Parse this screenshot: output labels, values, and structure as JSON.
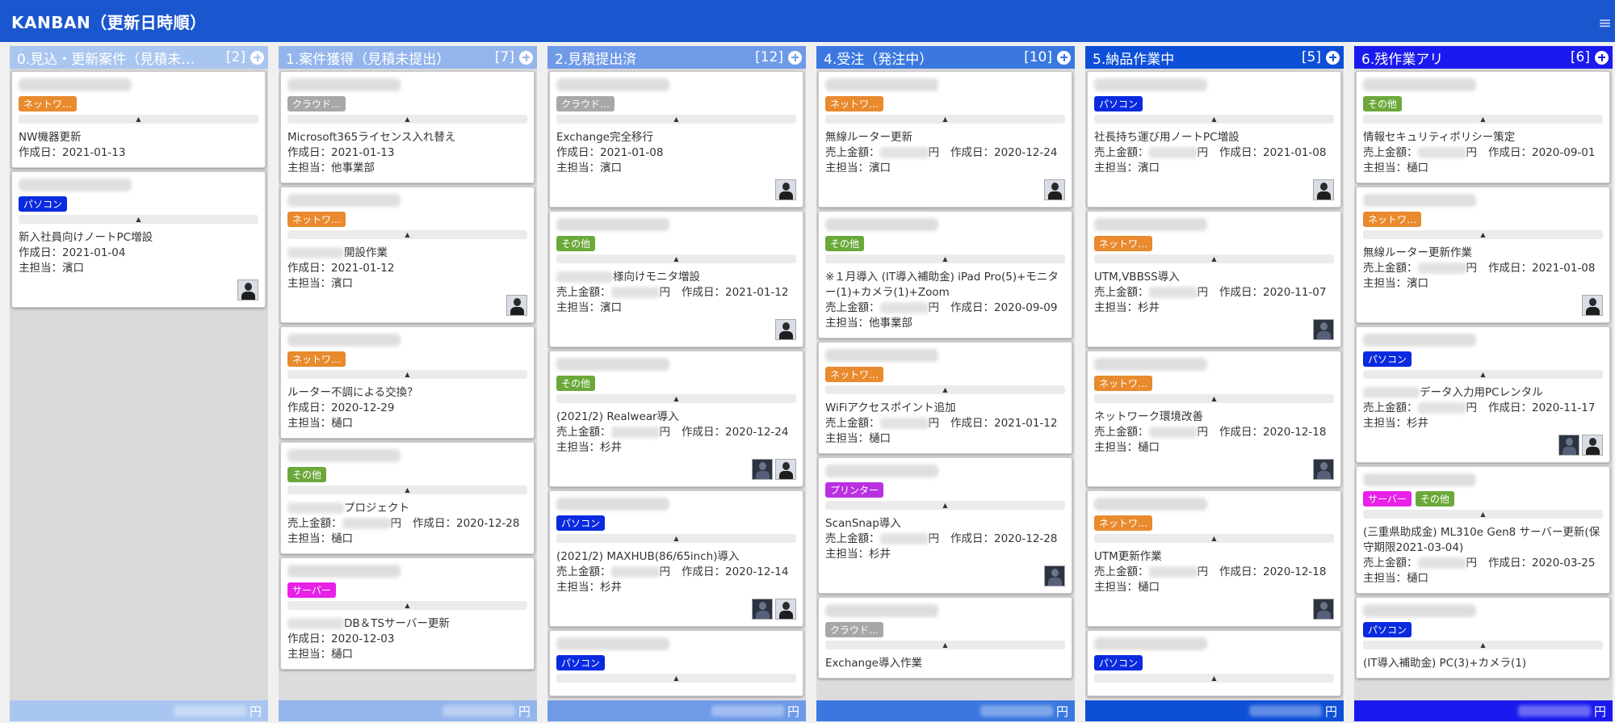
{
  "header": {
    "title": "KANBAN（更新日時順）",
    "menu_icon": "≡"
  },
  "colors": {
    "network": "#e88a2d",
    "cloud": "#a7a7a7",
    "pc": "#0a2ae0",
    "other": "#6ba83a",
    "server": "#e820e8",
    "printer": "#b830e0"
  },
  "columns": [
    {
      "title": "0.見込・更新案件（見積未…",
      "count": "[2]",
      "header_color": "#a9c6f0",
      "footer_color": "#a9c6f0",
      "footer_text": "円",
      "cards": [
        {
          "tags": [
            {
              "label": "ネットワ…",
              "type": "network"
            }
          ],
          "title": "NW機器更新",
          "lines": [
            "作成日：2021-01-13"
          ],
          "avatars": []
        },
        {
          "tags": [
            {
              "label": "パソコン",
              "type": "pc"
            }
          ],
          "title": "新入社員向けノートPC増設",
          "lines": [
            "作成日：2021-01-04",
            "主担当：濱口"
          ],
          "avatars": [
            "light"
          ]
        }
      ]
    },
    {
      "title": "1.案件獲得（見積未提出）",
      "count": "[7]",
      "header_color": "#93b5ec",
      "footer_color": "#93b5ec",
      "footer_text": "円",
      "cards": [
        {
          "tags": [
            {
              "label": "クラウド…",
              "type": "cloud"
            }
          ],
          "title": "Microsoft365ライセンス入れ替え",
          "lines": [
            "作成日：2021-01-13",
            "主担当：他事業部"
          ],
          "avatars": []
        },
        {
          "tags": [
            {
              "label": "ネットワ…",
              "type": "network"
            }
          ],
          "title": "開設作業",
          "blur_prefix": true,
          "lines": [
            "作成日：2021-01-12",
            "主担当：濱口"
          ],
          "avatars": [
            "light"
          ]
        },
        {
          "tags": [
            {
              "label": "ネットワ…",
              "type": "network"
            }
          ],
          "title": "ルーター不調による交換？",
          "lines": [
            "作成日：2020-12-29",
            "主担当：樋口"
          ],
          "avatars": []
        },
        {
          "tags": [
            {
              "label": "その他",
              "type": "other"
            }
          ],
          "title": "プロジェクト",
          "blur_prefix": true,
          "sales": true,
          "sales_label": "売上金額：",
          "yen": "円",
          "date": "作成日：2020-12-28",
          "lines": [
            "主担当：樋口"
          ],
          "avatars": []
        },
        {
          "tags": [
            {
              "label": "サーバー",
              "type": "server"
            }
          ],
          "title": "DB＆TSサーバー更新",
          "blur_prefix": true,
          "lines": [
            "作成日：2020-12-03",
            "主担当：樋口"
          ],
          "avatars": []
        }
      ]
    },
    {
      "title": "2.見積提出済",
      "count": "[12]",
      "header_color": "#6f9ae8",
      "footer_color": "#6f9ae8",
      "footer_text": "円",
      "cards": [
        {
          "tags": [
            {
              "label": "クラウド…",
              "type": "cloud"
            }
          ],
          "title": "Exchange完全移行",
          "lines": [
            "作成日：2021-01-08",
            "主担当：濱口"
          ],
          "avatars": [
            "light"
          ]
        },
        {
          "tags": [
            {
              "label": "その他",
              "type": "other"
            }
          ],
          "title": "様向けモニタ増設",
          "blur_prefix": true,
          "sales": true,
          "sales_label": "売上金額：",
          "yen": "円",
          "date": "作成日：2021-01-12",
          "lines": [
            "主担当：濱口"
          ],
          "avatars": [
            "light"
          ]
        },
        {
          "tags": [
            {
              "label": "その他",
              "type": "other"
            }
          ],
          "title": "(2021/2) Realwear導入",
          "sales": true,
          "sales_label": "売上金額：",
          "yen": "円",
          "date": "作成日：2020-12-24",
          "lines": [
            "主担当：杉井"
          ],
          "avatars": [
            "dark",
            "light"
          ]
        },
        {
          "tags": [
            {
              "label": "パソコン",
              "type": "pc"
            }
          ],
          "title": "(2021/2) MAXHUB(86/65inch)導入",
          "sales": true,
          "sales_label": "売上金額：",
          "yen": "円",
          "date": "作成日：2020-12-14",
          "lines": [
            "主担当：杉井"
          ],
          "avatars": [
            "dark",
            "light"
          ]
        },
        {
          "tags": [
            {
              "label": "パソコン",
              "type": "pc"
            }
          ],
          "title": "",
          "lines": [],
          "avatars": []
        }
      ]
    },
    {
      "title": "4.受注（発注中）",
      "count": "[10]",
      "header_color": "#3a78e0",
      "footer_color": "#3a78e0",
      "footer_text": "円",
      "cards": [
        {
          "tags": [
            {
              "label": "ネットワ…",
              "type": "network"
            }
          ],
          "title": "無線ルーター更新",
          "sales": true,
          "sales_label": "売上金額：",
          "yen": "円",
          "date": "作成日：2020-12-24",
          "lines": [
            "主担当：濱口"
          ],
          "avatars": [
            "light"
          ]
        },
        {
          "tags": [
            {
              "label": "その他",
              "type": "other"
            }
          ],
          "title": "※１月導入 (IT導入補助金) iPad Pro(5)+モニター(1)+カメラ(1)+Zoom",
          "sales": true,
          "sales_label": "売上金額：",
          "yen": "円",
          "date": "作成日：2020-09-09",
          "lines": [
            "主担当：他事業部"
          ],
          "avatars": []
        },
        {
          "tags": [
            {
              "label": "ネットワ…",
              "type": "network"
            }
          ],
          "title": "WiFiアクセスポイント追加",
          "sales": true,
          "sales_label": "売上金額：",
          "yen": "円",
          "date": "作成日：2021-01-12",
          "lines": [
            "主担当：樋口"
          ],
          "avatars": []
        },
        {
          "tags": [
            {
              "label": "プリンター",
              "type": "printer"
            }
          ],
          "title": "ScanSnap導入",
          "sales": true,
          "sales_label": "売上金額：",
          "yen": "円",
          "date": "作成日：2020-12-28",
          "lines": [
            "主担当：杉井"
          ],
          "avatars": [
            "dark"
          ]
        },
        {
          "tags": [
            {
              "label": "クラウド…",
              "type": "cloud"
            }
          ],
          "title": "Exchange導入作業",
          "lines": [],
          "avatars": []
        }
      ]
    },
    {
      "title": "5.納品作業中",
      "count": "[5]",
      "header_color": "#0e4fd8",
      "footer_color": "#0e4fd8",
      "footer_text": "円",
      "cards": [
        {
          "tags": [
            {
              "label": "パソコン",
              "type": "pc"
            }
          ],
          "title": "社長持ち運び用ノートPC増設",
          "sales": true,
          "sales_label": "売上金額：",
          "yen": "円",
          "date": "作成日：2021-01-08",
          "lines": [
            "主担当：濱口"
          ],
          "avatars": [
            "light"
          ]
        },
        {
          "tags": [
            {
              "label": "ネットワ…",
              "type": "network"
            }
          ],
          "title": "UTM,VBBSS導入",
          "sales": true,
          "sales_label": "売上金額：",
          "yen": "円",
          "date": "作成日：2020-11-07",
          "lines": [
            "主担当：杉井"
          ],
          "avatars": [
            "dark"
          ]
        },
        {
          "tags": [
            {
              "label": "ネットワ…",
              "type": "network"
            }
          ],
          "title": "ネットワーク環境改善",
          "sales": true,
          "sales_label": "売上金額：",
          "yen": "円",
          "date": "作成日：2020-12-18",
          "lines": [
            "主担当：樋口"
          ],
          "avatars": [
            "dark"
          ]
        },
        {
          "tags": [
            {
              "label": "ネットワ…",
              "type": "network"
            }
          ],
          "title": "UTM更新作業",
          "sales": true,
          "sales_label": "売上金額：",
          "yen": "円",
          "date": "作成日：2020-12-18",
          "lines": [
            "主担当：樋口"
          ],
          "avatars": [
            "dark"
          ]
        },
        {
          "tags": [
            {
              "label": "パソコン",
              "type": "pc"
            }
          ],
          "title": "",
          "lines": [],
          "avatars": []
        }
      ]
    },
    {
      "title": "6.残作業アリ",
      "count": "[6]",
      "header_color": "#1a1aee",
      "footer_color": "#1a1aee",
      "footer_text": "円",
      "cards": [
        {
          "tags": [
            {
              "label": "その他",
              "type": "other"
            }
          ],
          "title": "情報セキュリティポリシー策定",
          "sales": true,
          "sales_label": "売上金額：",
          "yen": "円",
          "date": "作成日：2020-09-01",
          "lines": [
            "主担当：樋口"
          ],
          "avatars": []
        },
        {
          "tags": [
            {
              "label": "ネットワ…",
              "type": "network"
            }
          ],
          "title": "無線ルーター更新作業",
          "sales": true,
          "sales_label": "売上金額：",
          "yen": "円",
          "date": "作成日：2021-01-08",
          "lines": [
            "主担当：濱口"
          ],
          "avatars": [
            "light"
          ]
        },
        {
          "tags": [
            {
              "label": "パソコン",
              "type": "pc"
            }
          ],
          "title": "データ入力用PCレンタル",
          "blur_prefix": true,
          "sales": true,
          "sales_label": "売上金額：",
          "yen": "円",
          "date": "作成日：2020-11-17",
          "lines": [
            "主担当：杉井"
          ],
          "avatars": [
            "dark",
            "light"
          ]
        },
        {
          "tags": [
            {
              "label": "サーバー",
              "type": "server"
            },
            {
              "label": "その他",
              "type": "other"
            }
          ],
          "title": "(三重県助成金) ML310e Gen8 サーバー更新(保守期限2021-03-04)",
          "sales": true,
          "sales_label": "売上金額：",
          "yen": "円",
          "date": "作成日：2020-03-25",
          "lines": [
            "主担当：樋口"
          ],
          "avatars": []
        },
        {
          "tags": [
            {
              "label": "パソコン",
              "type": "pc"
            }
          ],
          "title": "(IT導入補助金) PC(3)+カメラ(1)",
          "lines": [],
          "avatars": []
        }
      ]
    }
  ]
}
